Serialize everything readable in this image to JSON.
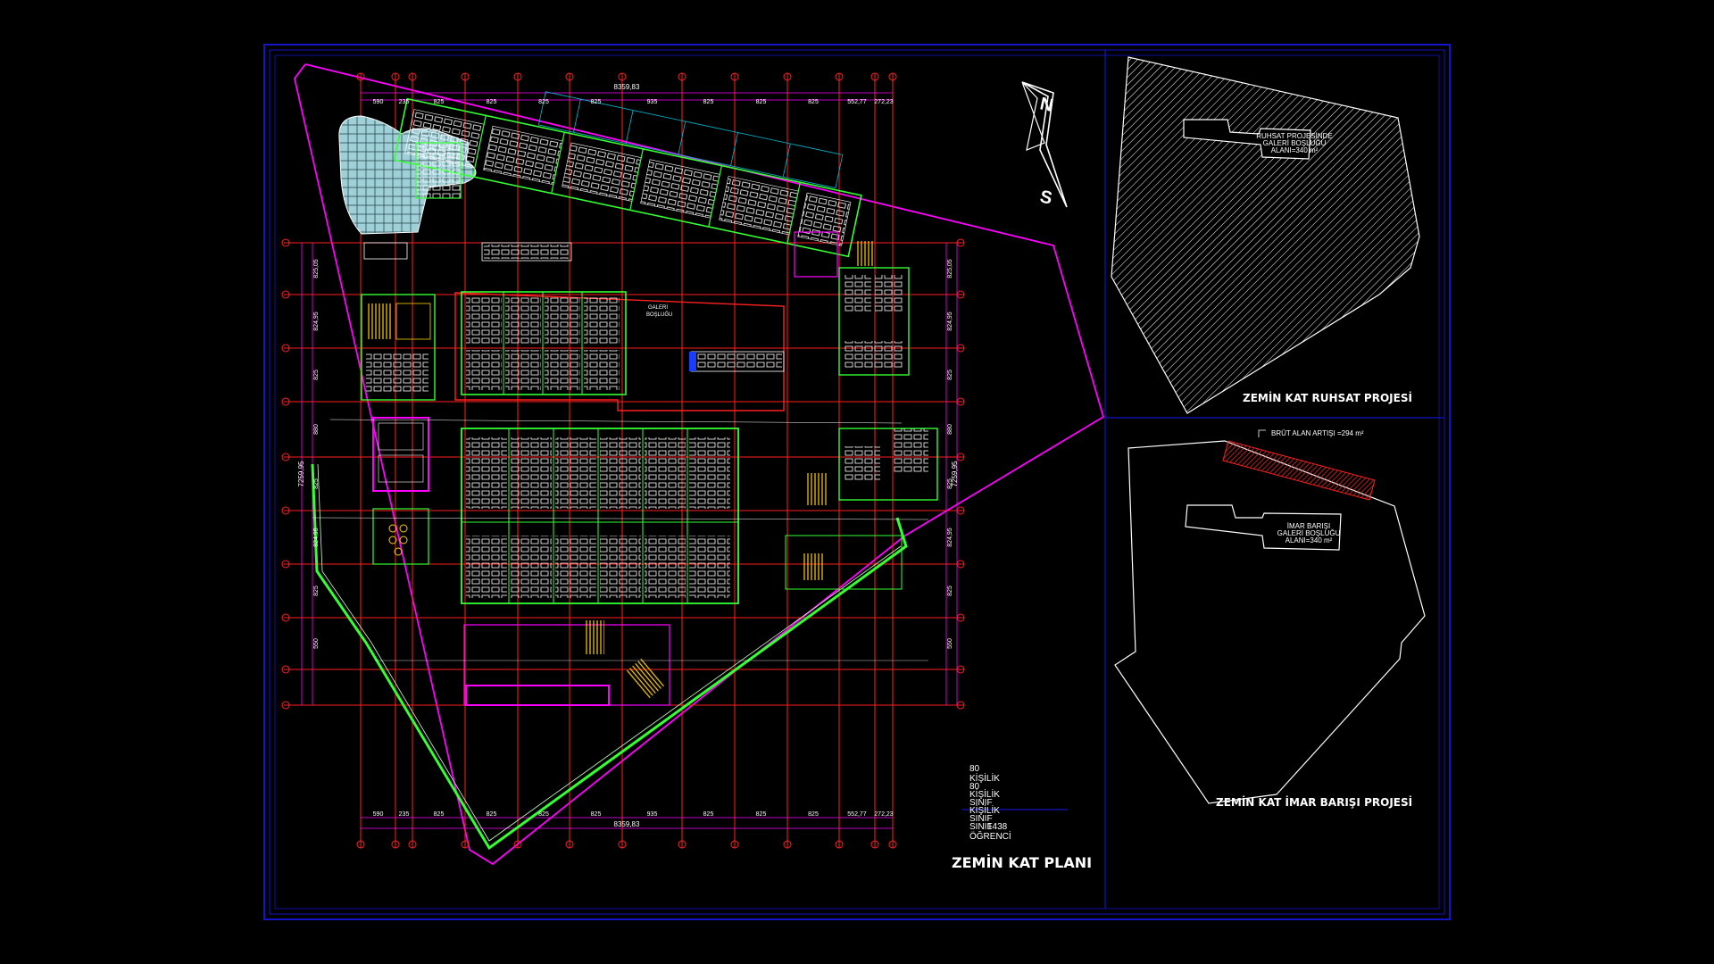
{
  "drawing": {
    "main_title": "ZEMİN KAT PLANI",
    "panel_top_title": "ZEMİN KAT RUHSAT PROJESİ",
    "panel_bottom_title": "ZEMİN KAT İMAR BARIŞI PROJESİ",
    "top_panel_label_lines": [
      "RUHSAT PROJESİNDE",
      "GALERİ BOŞLUĞU",
      "ALANI=340 m²"
    ],
    "bottom_panel_label_lines": [
      "İMAR BARIŞI",
      "GALERİ BOŞLUĞU",
      "ALANI=340 m²"
    ],
    "brut_alan_label": "BRÜT ALAN ARTIŞI =294 m²",
    "galeri_label": [
      "GALERİ",
      "BOŞLUĞU"
    ],
    "north_label": "N",
    "south_label": "S",
    "dim_top_segments": [
      "590",
      "235",
      "825",
      "825",
      "825",
      "825",
      "935",
      "825",
      "825",
      "825",
      "552,77",
      "272,23"
    ],
    "dim_top_total": "8359,83",
    "dim_left_segments": [
      "825,05",
      "824,95",
      "825",
      "880",
      "825",
      "824,95",
      "825",
      "550"
    ],
    "dim_left_total": "7259,95",
    "capacity_lines": [
      "80",
      "KİŞİLİK",
      "80",
      "KİŞİLİK",
      "SINIF",
      "KİŞİLİK",
      "SINIF",
      "SINIF",
      "1438",
      "ÖĞRENCİ"
    ],
    "colors": {
      "frame": "#1414c8",
      "magenta": "#ff00ff",
      "red": "#ff2020",
      "green": "#33ff33",
      "white": "#ffffff",
      "cyan": "#00ffff",
      "yellow": "#ffff00",
      "hatch_red": "#d01010"
    }
  }
}
